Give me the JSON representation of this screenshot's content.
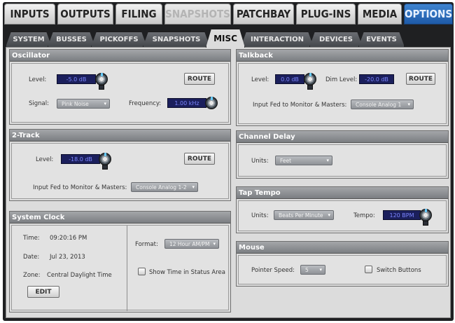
{
  "top_tabs": [
    "INPUTS",
    "OUTPUTS",
    "FILING",
    "SNAPSHOTS",
    "PATCHBAY",
    "PLUG-INS",
    "MEDIA",
    "OPTIONS"
  ],
  "sub_tabs": [
    "SYSTEM",
    "BUSSES",
    "PICKOFFS",
    "SNAPSHOTS",
    "MISC",
    "INTERACTION",
    "DEVICES",
    "EVENTS"
  ],
  "oscillator": {
    "title": "Oscillator",
    "level_label": "Level:",
    "level_value": "-5.0 dB",
    "route_label": "ROUTE",
    "signal_label": "Signal:",
    "signal_value": "Pink Noise",
    "frequency_label": "Frequency:",
    "frequency_value": "1.00 kHz"
  },
  "two_track": {
    "title": "2-Track",
    "level_label": "Level:",
    "level_value": "-18.0 dB",
    "route_label": "ROUTE",
    "input_fed_label": "Input Fed to Monitor & Masters:",
    "input_fed_value": "Console Analog 1-2"
  },
  "system_clock": {
    "title": "System Clock",
    "time_label": "Time:",
    "time_value": "09:20:16 PM",
    "date_label": "Date:",
    "date_value": "Jul 23, 2013",
    "zone_label": "Zone:",
    "zone_value": "Central Daylight Time",
    "edit_label": "EDIT",
    "format_label": "Format:",
    "format_value": "12 Hour AM/PM",
    "show_time_label": "Show Time in Status Area"
  },
  "talkback": {
    "title": "Talkback",
    "level_label": "Level:",
    "level_value": "0.0 dB",
    "dim_label": "Dim Level:",
    "dim_value": "-20.0 dB",
    "route_label": "ROUTE",
    "input_fed_label": "Input Fed to Monitor & Masters:",
    "input_fed_value": "Console Analog 1"
  },
  "channel_delay": {
    "title": "Channel Delay",
    "units_label": "Units:",
    "units_value": "Feet"
  },
  "tap_tempo": {
    "title": "Tap Tempo",
    "units_label": "Units:",
    "units_value": "Beats Per Minute",
    "tempo_label": "Tempo:",
    "tempo_value": "120 BPM"
  },
  "mouse": {
    "title": "Mouse",
    "pointer_label": "Pointer Speed:",
    "pointer_value": "5",
    "switch_label": "Switch Buttons"
  }
}
